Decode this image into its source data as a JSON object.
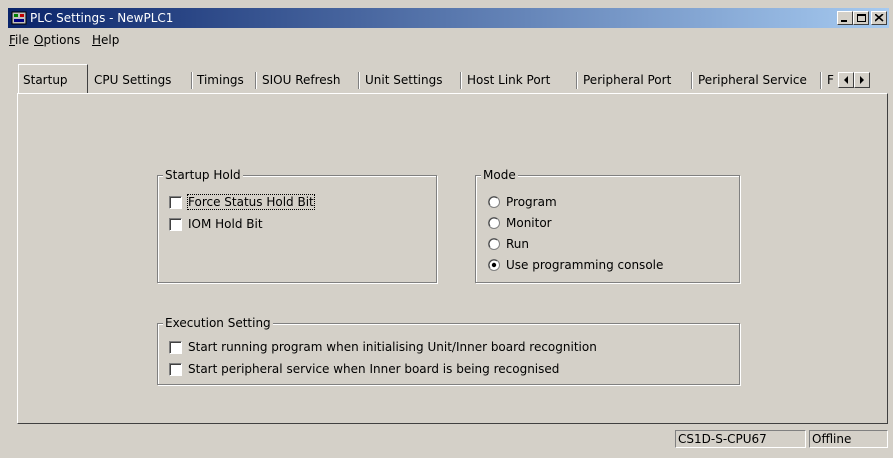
{
  "window": {
    "title": "PLC Settings - NewPLC1",
    "controls": {
      "minimize": "minimize-icon",
      "maximize": "maximize-icon",
      "close": "close-icon"
    }
  },
  "menu": [
    {
      "label": "File",
      "mnemonic": "F",
      "rest": "ile"
    },
    {
      "label": "Options",
      "mnemonic": "O",
      "rest": "ptions"
    },
    {
      "label": "Help",
      "mnemonic": "H",
      "rest": "elp"
    }
  ],
  "tabs": [
    {
      "label": "Startup",
      "active": true
    },
    {
      "label": "CPU Settings"
    },
    {
      "label": "Timings"
    },
    {
      "label": "SIOU Refresh"
    },
    {
      "label": "Unit Settings"
    },
    {
      "label": "Host Link Port"
    },
    {
      "label": "Peripheral Port"
    },
    {
      "label": "Peripheral Service"
    },
    {
      "label": "F"
    }
  ],
  "startup_hold": {
    "title": "Startup Hold",
    "options": [
      {
        "label": "Force Status Hold Bit",
        "checked": false,
        "focused": true
      },
      {
        "label": "IOM Hold Bit",
        "checked": false
      }
    ]
  },
  "mode": {
    "title": "Mode",
    "options": [
      {
        "label": "Program",
        "selected": false
      },
      {
        "label": "Monitor",
        "selected": false
      },
      {
        "label": "Run",
        "selected": false
      },
      {
        "label": "Use programming console",
        "selected": true
      }
    ]
  },
  "execution_setting": {
    "title": "Execution Setting",
    "options": [
      {
        "label": "Start running program when initialising Unit/Inner board recognition",
        "checked": false
      },
      {
        "label": "Start peripheral service when Inner board is being recognised",
        "checked": false
      }
    ]
  },
  "status": {
    "cpu_model": "CS1D-S-CPU67",
    "connection": "Offline"
  },
  "colors": {
    "titlebar_start": "#0a246a",
    "titlebar_end": "#a6caf0",
    "face": "#d4d0c8"
  }
}
